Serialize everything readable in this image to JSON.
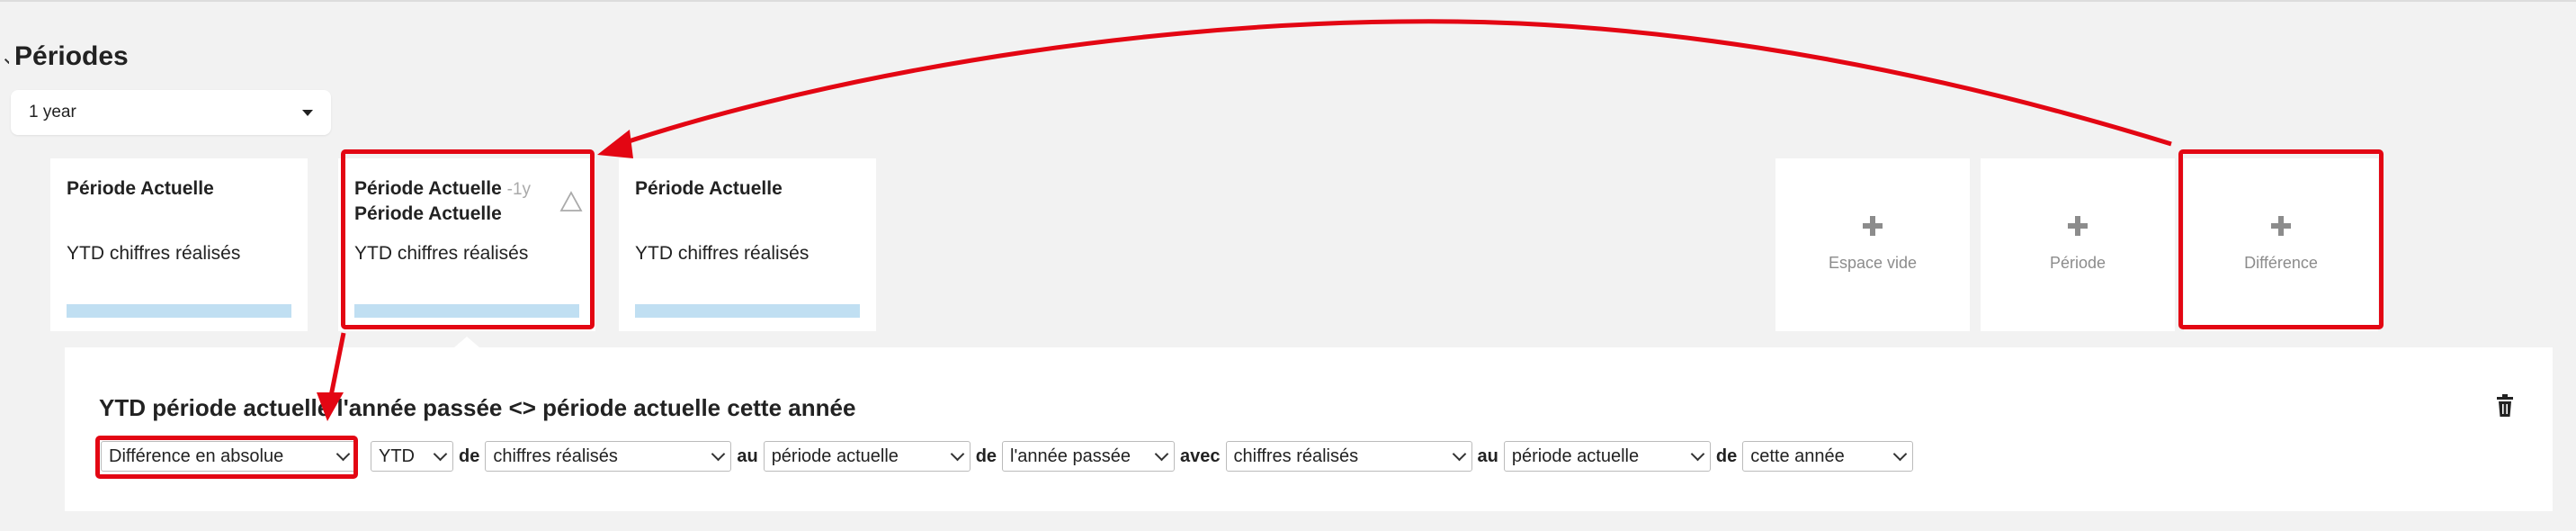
{
  "section": {
    "title": "Périodes"
  },
  "period_select": {
    "value": "1 year"
  },
  "period_cards": [
    {
      "title": "Période Actuelle",
      "subtitle": "",
      "line2": "",
      "text": "YTD chiffres réalisés"
    },
    {
      "title": "Période Actuelle",
      "subtitle": "-1y",
      "line2": "Période Actuelle",
      "text": "YTD chiffres réalisés"
    },
    {
      "title": "Période Actuelle",
      "subtitle": "",
      "line2": "",
      "text": "YTD chiffres réalisés"
    }
  ],
  "add_cards": [
    {
      "label": "Espace vide"
    },
    {
      "label": "Période"
    },
    {
      "label": "Différence"
    }
  ],
  "detail": {
    "title": "YTD période actuelle l'année passée <> période actuelle cette année",
    "selects": [
      {
        "value": "Différence en absolue"
      },
      {
        "value": "YTD"
      },
      {
        "value": "chiffres réalisés"
      },
      {
        "value": "période actuelle"
      },
      {
        "value": "l'année passée"
      },
      {
        "value": "chiffres réalisés"
      },
      {
        "value": "période actuelle"
      },
      {
        "value": "cette année"
      }
    ],
    "connectors": [
      "de",
      "au",
      "de",
      "avec",
      "au",
      "de"
    ]
  },
  "colors": {
    "accent_bar": "#c0dff2",
    "annotation": "#e30613"
  }
}
